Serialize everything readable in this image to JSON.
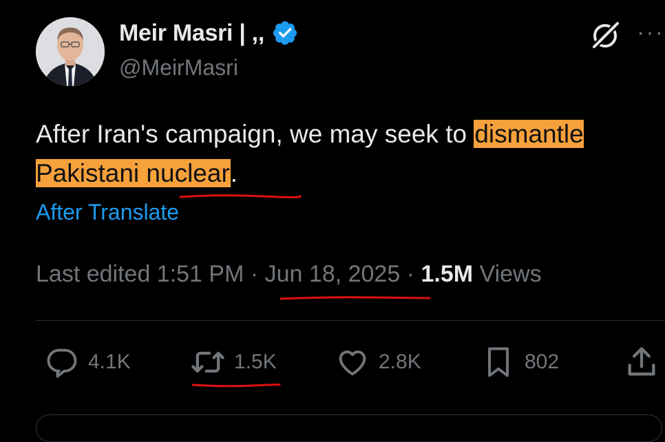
{
  "author": {
    "name": "Meir Masri | ,,",
    "handle": "@MeirMasri",
    "verified": true
  },
  "tweet": {
    "text_before": "After Iran's campaign, we may seek to ",
    "text_highlight": "dismantle Pakistani nuclear",
    "text_after": ".",
    "highlight_color": "#f6a13c",
    "translate_label": "After Translate"
  },
  "meta": {
    "edited_label": "Last edited 1:51 PM",
    "separator": " · ",
    "date": "Jun 18, 2025",
    "views_count": "1.5M",
    "views_label": " Views"
  },
  "actions": {
    "replies": "4.1K",
    "reposts": "1.5K",
    "likes": "2.8K",
    "bookmarks": "802"
  },
  "colors": {
    "accent": "#1d9bf0",
    "annotation_red": "#e01010"
  },
  "icons": [
    "verified-badge-icon",
    "grok-icon",
    "more-icon",
    "reply-icon",
    "repost-icon",
    "like-icon",
    "bookmark-icon",
    "share-icon"
  ]
}
